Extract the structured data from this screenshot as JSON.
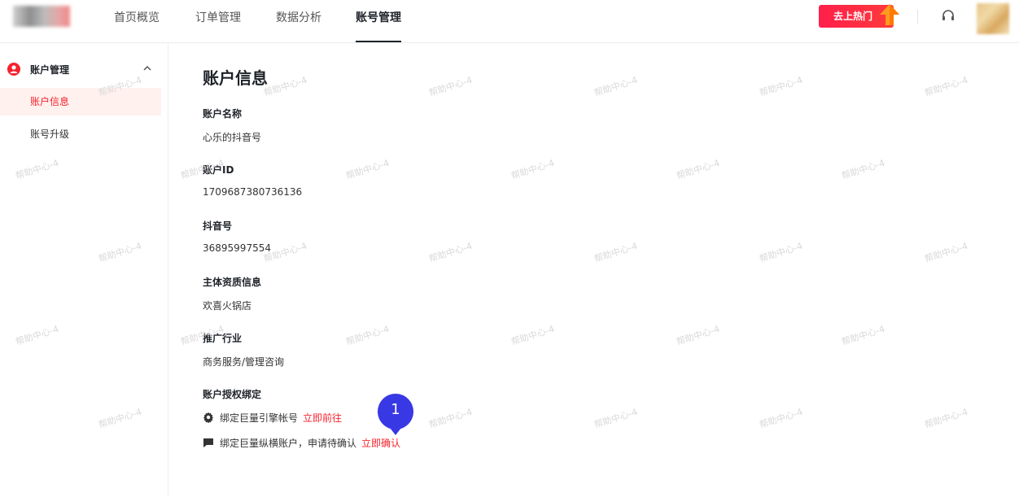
{
  "header": {
    "tabs": [
      {
        "label": "首页概览"
      },
      {
        "label": "订单管理"
      },
      {
        "label": "数据分析"
      },
      {
        "label": "账号管理",
        "active": true
      }
    ],
    "hot_button": "去上热门",
    "support_icon": "headset-icon",
    "accent_color": "#ff1f4b"
  },
  "sidebar": {
    "group": {
      "label": "账户管理",
      "icon": "user-circle-icon"
    },
    "items": [
      {
        "label": "账户信息",
        "active": true
      },
      {
        "label": "账号升级"
      }
    ]
  },
  "main": {
    "title": "账户信息",
    "fields": [
      {
        "label": "账户名称",
        "value": "心乐的抖音号"
      },
      {
        "label": "账户ID",
        "value": "1709687380736136"
      },
      {
        "label": "抖音号",
        "value": "36895997554"
      },
      {
        "label": "主体资质信息",
        "value": "欢喜火锅店"
      },
      {
        "label": "推广行业",
        "value": "商务服务/管理咨询"
      }
    ],
    "binding": {
      "label": "账户授权绑定",
      "rows": [
        {
          "text": "绑定巨量引擎帐号",
          "link": "立即前往",
          "icon": "gear-icon"
        },
        {
          "text": "绑定巨量纵横账户，申请待确认",
          "link": "立即确认",
          "icon": "flag-icon"
        }
      ]
    },
    "step_badge": "1"
  },
  "watermark": "帮助中心-4",
  "colors": {
    "active_red": "#f5222d",
    "badge_blue": "#3838e5",
    "active_bg": "#fff1ee"
  }
}
